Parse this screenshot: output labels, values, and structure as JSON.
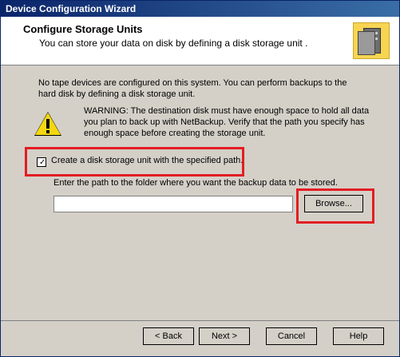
{
  "window": {
    "title": "Device Configuration Wizard"
  },
  "header": {
    "title": "Configure Storage Units",
    "subtitle": "You can store your data on disk by defining a disk storage unit ."
  },
  "content": {
    "info_text": "No tape devices are configured on this system. You can perform backups to the hard disk by defining a disk storage unit.",
    "warning_text": "WARNING: The destination disk must have enough space to hold all data you plan to back up with NetBackup. Verify that the path you specify has enough space before creating the storage unit.",
    "checkbox_label": "Create a disk storage unit with the specified path.",
    "path_label": "Enter the path to the folder where you want the backup data to be stored.",
    "path_value": "",
    "browse_label": "Browse..."
  },
  "buttons": {
    "back": "< Back",
    "next": "Next >",
    "cancel": "Cancel",
    "help": "Help"
  },
  "colors": {
    "highlight": "#e31d23",
    "warning": "#f3d70f"
  }
}
